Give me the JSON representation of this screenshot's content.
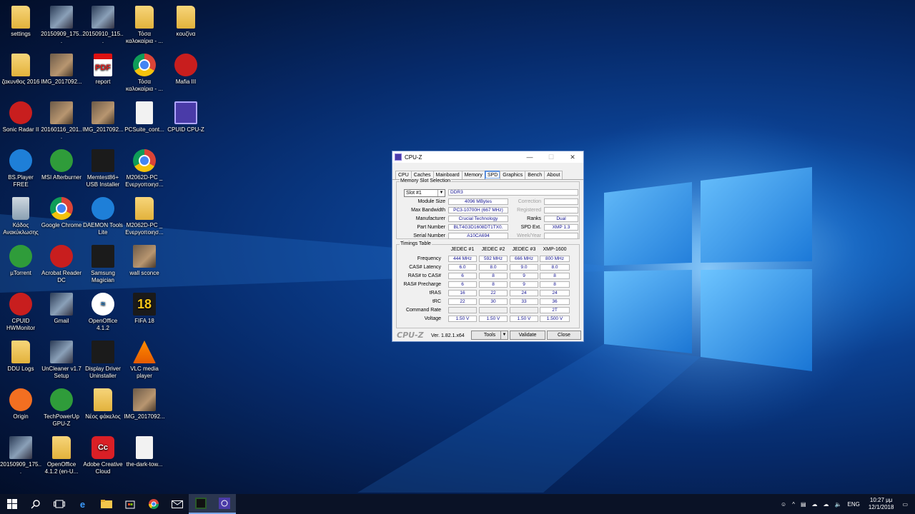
{
  "desktop": {
    "icons": [
      {
        "label": "settings",
        "type": "folder"
      },
      {
        "label": "20150909_175...",
        "type": "photo2"
      },
      {
        "label": "20150910_115...",
        "type": "photo2"
      },
      {
        "label": "Τόσα καλοκαίρια - ...",
        "type": "folder"
      },
      {
        "label": "κουζίνα",
        "type": "folder"
      },
      {
        "label": "ζακυνθος 2016",
        "type": "folder"
      },
      {
        "label": "IMG_2017092...",
        "type": "photo"
      },
      {
        "label": "report",
        "type": "pdf"
      },
      {
        "label": "Τόσα καλοκαίρια - ...",
        "type": "chrome"
      },
      {
        "label": "Mafia III",
        "type": "red"
      },
      {
        "label": "Sonic Radar II",
        "type": "red"
      },
      {
        "label": "20160116_201...",
        "type": "photo"
      },
      {
        "label": "IMG_2017092...",
        "type": "photo"
      },
      {
        "label": "PCSuite_cont...",
        "type": "white"
      },
      {
        "label": "CPUID CPU-Z",
        "type": "cpuz"
      },
      {
        "label": "BS.Player FREE",
        "type": "blue"
      },
      {
        "label": "MSI Afterburner",
        "type": "green"
      },
      {
        "label": "Memtest86+ USB Installer",
        "type": "black"
      },
      {
        "label": "M2062D-PC _ Ενεργοποιησ...",
        "type": "chrome"
      },
      {
        "label": "Κάδος Ανακύκλωσης",
        "type": "bin"
      },
      {
        "label": "Google Chrome",
        "type": "chrome"
      },
      {
        "label": "DAEMON Tools Lite",
        "type": "blue"
      },
      {
        "label": "M2062D-PC _ Ενεργοποιησ...",
        "type": "folder"
      },
      {
        "label": "µTorrent",
        "type": "green"
      },
      {
        "label": "Acrobat Reader DC",
        "type": "red"
      },
      {
        "label": "Samsung Magician",
        "type": "black"
      },
      {
        "label": "wall sconce",
        "type": "photo"
      },
      {
        "label": "CPUID HWMonitor",
        "type": "red"
      },
      {
        "label": "Gmail",
        "type": "photo2"
      },
      {
        "label": "OpenOffice 4.1.2",
        "type": "oo"
      },
      {
        "label": "FIFA 18",
        "type": "fifa"
      },
      {
        "label": "DDU Logs",
        "type": "folder"
      },
      {
        "label": "UnCleaner v1.7 Setup",
        "type": "photo2"
      },
      {
        "label": "Display Driver Uninstaller",
        "type": "black"
      },
      {
        "label": "VLC media player",
        "type": "vlc"
      },
      {
        "label": "Origin",
        "type": "orange"
      },
      {
        "label": "TechPowerUp GPU-Z",
        "type": "green"
      },
      {
        "label": "Νέος φάκελος",
        "type": "folder"
      },
      {
        "label": "IMG_2017092...",
        "type": "photo"
      },
      {
        "label": "20150909_175...",
        "type": "photo2"
      },
      {
        "label": "OpenOffice 4.1.2 (en-U...",
        "type": "folder"
      },
      {
        "label": "Adobe Creative Cloud",
        "type": "adobe"
      },
      {
        "label": "the-dark-tow...",
        "type": "white"
      }
    ]
  },
  "cpuz": {
    "title": "CPU-Z",
    "tabs": [
      "CPU",
      "Caches",
      "Mainboard",
      "Memory",
      "SPD",
      "Graphics",
      "Bench",
      "About"
    ],
    "active_tab": "SPD",
    "memory_slot_selection": {
      "group_title": "Memory Slot Selection",
      "slot": "Slot #1",
      "type": "DDR3",
      "module_size_label": "Module Size",
      "module_size": "4096 MBytes",
      "max_bandwidth_label": "Max Bandwidth",
      "max_bandwidth": "PC3-10700H (667 MHz)",
      "manufacturer_label": "Manufacturer",
      "manufacturer": "Crucial Technology",
      "part_number_label": "Part Number",
      "part_number": "BLT4G3D1608DT1TX0.",
      "serial_number_label": "Serial Number",
      "serial_number": "A10CA694",
      "correction_label": "Correction",
      "registered_label": "Registered",
      "ranks_label": "Ranks",
      "ranks": "Dual",
      "spd_ext_label": "SPD Ext.",
      "spd_ext": "XMP 1.3",
      "week_year_label": "Week/Year"
    },
    "timings": {
      "group_title": "Timings Table",
      "columns": [
        "JEDEC #1",
        "JEDEC #2",
        "JEDEC #3",
        "XMP-1600"
      ],
      "rows": [
        {
          "label": "Frequency",
          "values": [
            "444 MHz",
            "592 MHz",
            "666 MHz",
            "800 MHz"
          ]
        },
        {
          "label": "CAS# Latency",
          "values": [
            "6.0",
            "8.0",
            "9.0",
            "8.0"
          ]
        },
        {
          "label": "RAS# to CAS#",
          "values": [
            "6",
            "8",
            "9",
            "8"
          ]
        },
        {
          "label": "RAS# Precharge",
          "values": [
            "6",
            "8",
            "9",
            "8"
          ]
        },
        {
          "label": "tRAS",
          "values": [
            "16",
            "22",
            "24",
            "24"
          ]
        },
        {
          "label": "tRC",
          "values": [
            "22",
            "30",
            "33",
            "36"
          ]
        },
        {
          "label": "Command Rate",
          "values": [
            "",
            "",
            "",
            "2T"
          ]
        },
        {
          "label": "Voltage",
          "values": [
            "1.50 V",
            "1.50 V",
            "1.50 V",
            "1.500 V"
          ]
        }
      ]
    },
    "footer": {
      "logo": "CPU-Z",
      "version": "Ver. 1.82.1.x64",
      "tools_label": "Tools",
      "validate_label": "Validate",
      "close_label": "Close"
    }
  },
  "taskbar": {
    "tray": {
      "language": "ENG",
      "time": "10:27 μμ",
      "date": "12/1/2018"
    }
  }
}
